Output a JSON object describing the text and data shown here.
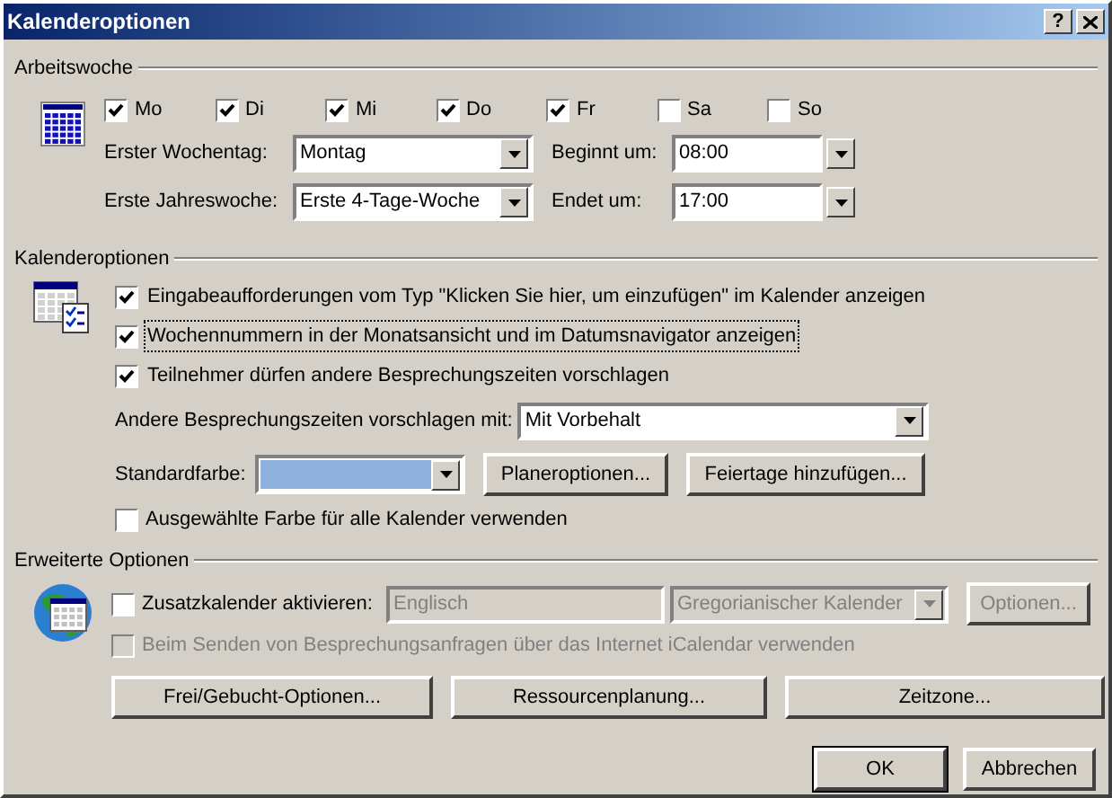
{
  "window": {
    "title": "Kalenderoptionen",
    "help": "?"
  },
  "arbeitswoche": {
    "title": "Arbeitswoche",
    "days": [
      {
        "label": "Mo",
        "checked": true
      },
      {
        "label": "Di",
        "checked": true
      },
      {
        "label": "Mi",
        "checked": true
      },
      {
        "label": "Do",
        "checked": true
      },
      {
        "label": "Fr",
        "checked": true
      },
      {
        "label": "Sa",
        "checked": false
      },
      {
        "label": "So",
        "checked": false
      }
    ],
    "first_day": {
      "label": "Erster Wochentag:",
      "value": "Montag"
    },
    "start": {
      "label": "Beginnt um:",
      "value": "08:00"
    },
    "first_week": {
      "label": "Erste Jahreswoche:",
      "value": "Erste 4-Tage-Woche"
    },
    "end": {
      "label": "Endet um:",
      "value": "17:00"
    }
  },
  "kalenderoptionen": {
    "title": "Kalenderoptionen",
    "options": [
      {
        "label": "Eingabeaufforderungen vom Typ \"Klicken Sie hier, um einzufügen\" im Kalender anzeigen",
        "checked": true,
        "focused": false
      },
      {
        "label": "Wochennummern in der Monatsansicht und im Datumsnavigator anzeigen",
        "checked": true,
        "focused": true
      },
      {
        "label": "Teilnehmer dürfen andere Besprechungszeiten vorschlagen",
        "checked": true,
        "focused": false
      }
    ],
    "propose": {
      "label": "Andere Besprechungszeiten vorschlagen mit:",
      "value": "Mit Vorbehalt"
    },
    "color": {
      "label": "Standardfarbe:",
      "color": "#8eb0dc"
    },
    "buttons": [
      "Planeroptionen...",
      "Feiertage hinzufügen..."
    ],
    "all_calendars": {
      "label": "Ausgewählte Farbe für alle Kalender verwenden",
      "checked": false
    }
  },
  "erweitert": {
    "title": "Erweiterte Optionen",
    "extra": {
      "label": "Zusatzkalender aktivieren:",
      "checked": false,
      "language": "Englisch",
      "calendar": "Gregorianischer Kalender",
      "disabled": true
    },
    "options_button": {
      "label": "Optionen...",
      "disabled": true
    },
    "icalendar": {
      "label": "Beim Senden von Besprechungsanfragen über das Internet iCalendar verwenden",
      "checked": false,
      "disabled": true
    },
    "buttons": [
      "Frei/Gebucht-Optionen...",
      "Ressourcenplanung...",
      "Zeitzone..."
    ]
  },
  "footer": [
    {
      "label": "OK",
      "default": true
    },
    {
      "label": "Abbrechen",
      "default": false
    }
  ]
}
